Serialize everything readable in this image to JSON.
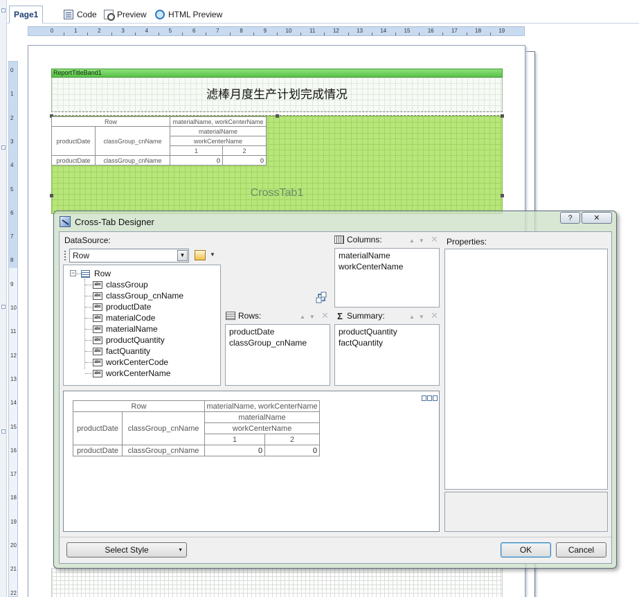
{
  "tabs": [
    {
      "label": "Page1",
      "icon": "page-icon",
      "active": true
    },
    {
      "label": "Code",
      "icon": "code-icon"
    },
    {
      "label": "Preview",
      "icon": "preview-icon"
    },
    {
      "label": "HTML Preview",
      "icon": "html-preview-icon"
    }
  ],
  "ruler": {
    "horizontal": [
      "0",
      "1",
      "2",
      "3",
      "4",
      "5",
      "6",
      "7",
      "8",
      "9",
      "10",
      "11",
      "12",
      "13",
      "14",
      "15",
      "16",
      "17",
      "18",
      "19"
    ],
    "vertical": [
      "0",
      "1",
      "2",
      "3",
      "4",
      "5",
      "6",
      "7",
      "8",
      "9",
      "10",
      "11",
      "12",
      "13",
      "14",
      "15",
      "16",
      "17",
      "18",
      "19",
      "20",
      "21",
      "22"
    ]
  },
  "report": {
    "title_band_label": "ReportTitleBand1",
    "title": "滤棒月度生产计划完成情况",
    "crosstab_label": "CrossTab1",
    "crosstab": {
      "row_header": "Row",
      "col_fields_header": "materialName, workCenterName",
      "row_field_1": "productDate",
      "row_field_2": "classGroup_cnName",
      "col_field_1": "materialName",
      "col_field_2": "workCenterName",
      "col_values": [
        "1",
        "2"
      ],
      "data_values": [
        "0",
        "0"
      ]
    }
  },
  "dialog": {
    "title": "Cross-Tab Designer",
    "help_button": "?",
    "close_button": "✕",
    "datasource_label": "DataSource:",
    "datasource_value": "Row",
    "tree_root": "Row",
    "abc_badge": "abc",
    "fields": [
      "classGroup",
      "classGroup_cnName",
      "productDate",
      "materialCode",
      "materialName",
      "productQuantity",
      "factQuantity",
      "workCenterCode",
      "workCenterName"
    ],
    "columns_label": "Columns:",
    "columns": [
      "materialName",
      "workCenterName"
    ],
    "rows_label": "Rows:",
    "rows": [
      "productDate",
      "classGroup_cnName"
    ],
    "summary_label": "Summary:",
    "summary": [
      "productQuantity",
      "factQuantity"
    ],
    "properties_label": "Properties:",
    "select_style_label": "Select Style",
    "ok_label": "OK",
    "cancel_label": "Cancel"
  },
  "colors": {
    "title_band": "#59c24a",
    "crosstab_area": "#b7e67a",
    "ruler": "#c9dbf0"
  }
}
